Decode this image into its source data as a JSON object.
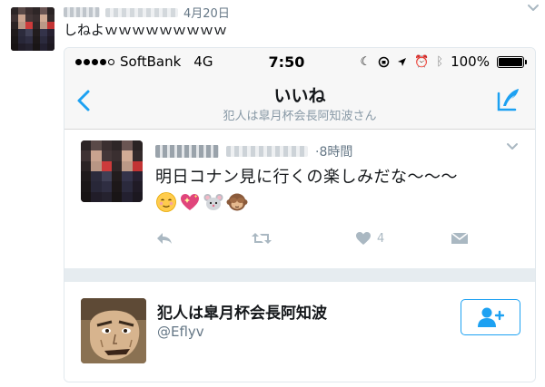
{
  "outer_tweet": {
    "date": "4月20日",
    "text": "しねよｗｗｗｗｗｗｗｗｗ"
  },
  "status_bar": {
    "carrier": "SoftBank",
    "network": "4G",
    "time": "7:50",
    "battery": "100%",
    "battery_level": 1.0
  },
  "nav": {
    "title": "いいね",
    "subtitle": "犯人は皐月杯会長阿知波さん"
  },
  "inner_tweet": {
    "time": "8時間",
    "text": "明日コナン見に行くの楽しみだな〜〜〜",
    "like_count": "4"
  },
  "user": {
    "name": "犯人は皐月杯会長阿知波",
    "handle": "@Eflyv"
  },
  "colors": {
    "accent": "#1da1f2",
    "muted": "#657786",
    "action_gray": "#aab8c2"
  }
}
